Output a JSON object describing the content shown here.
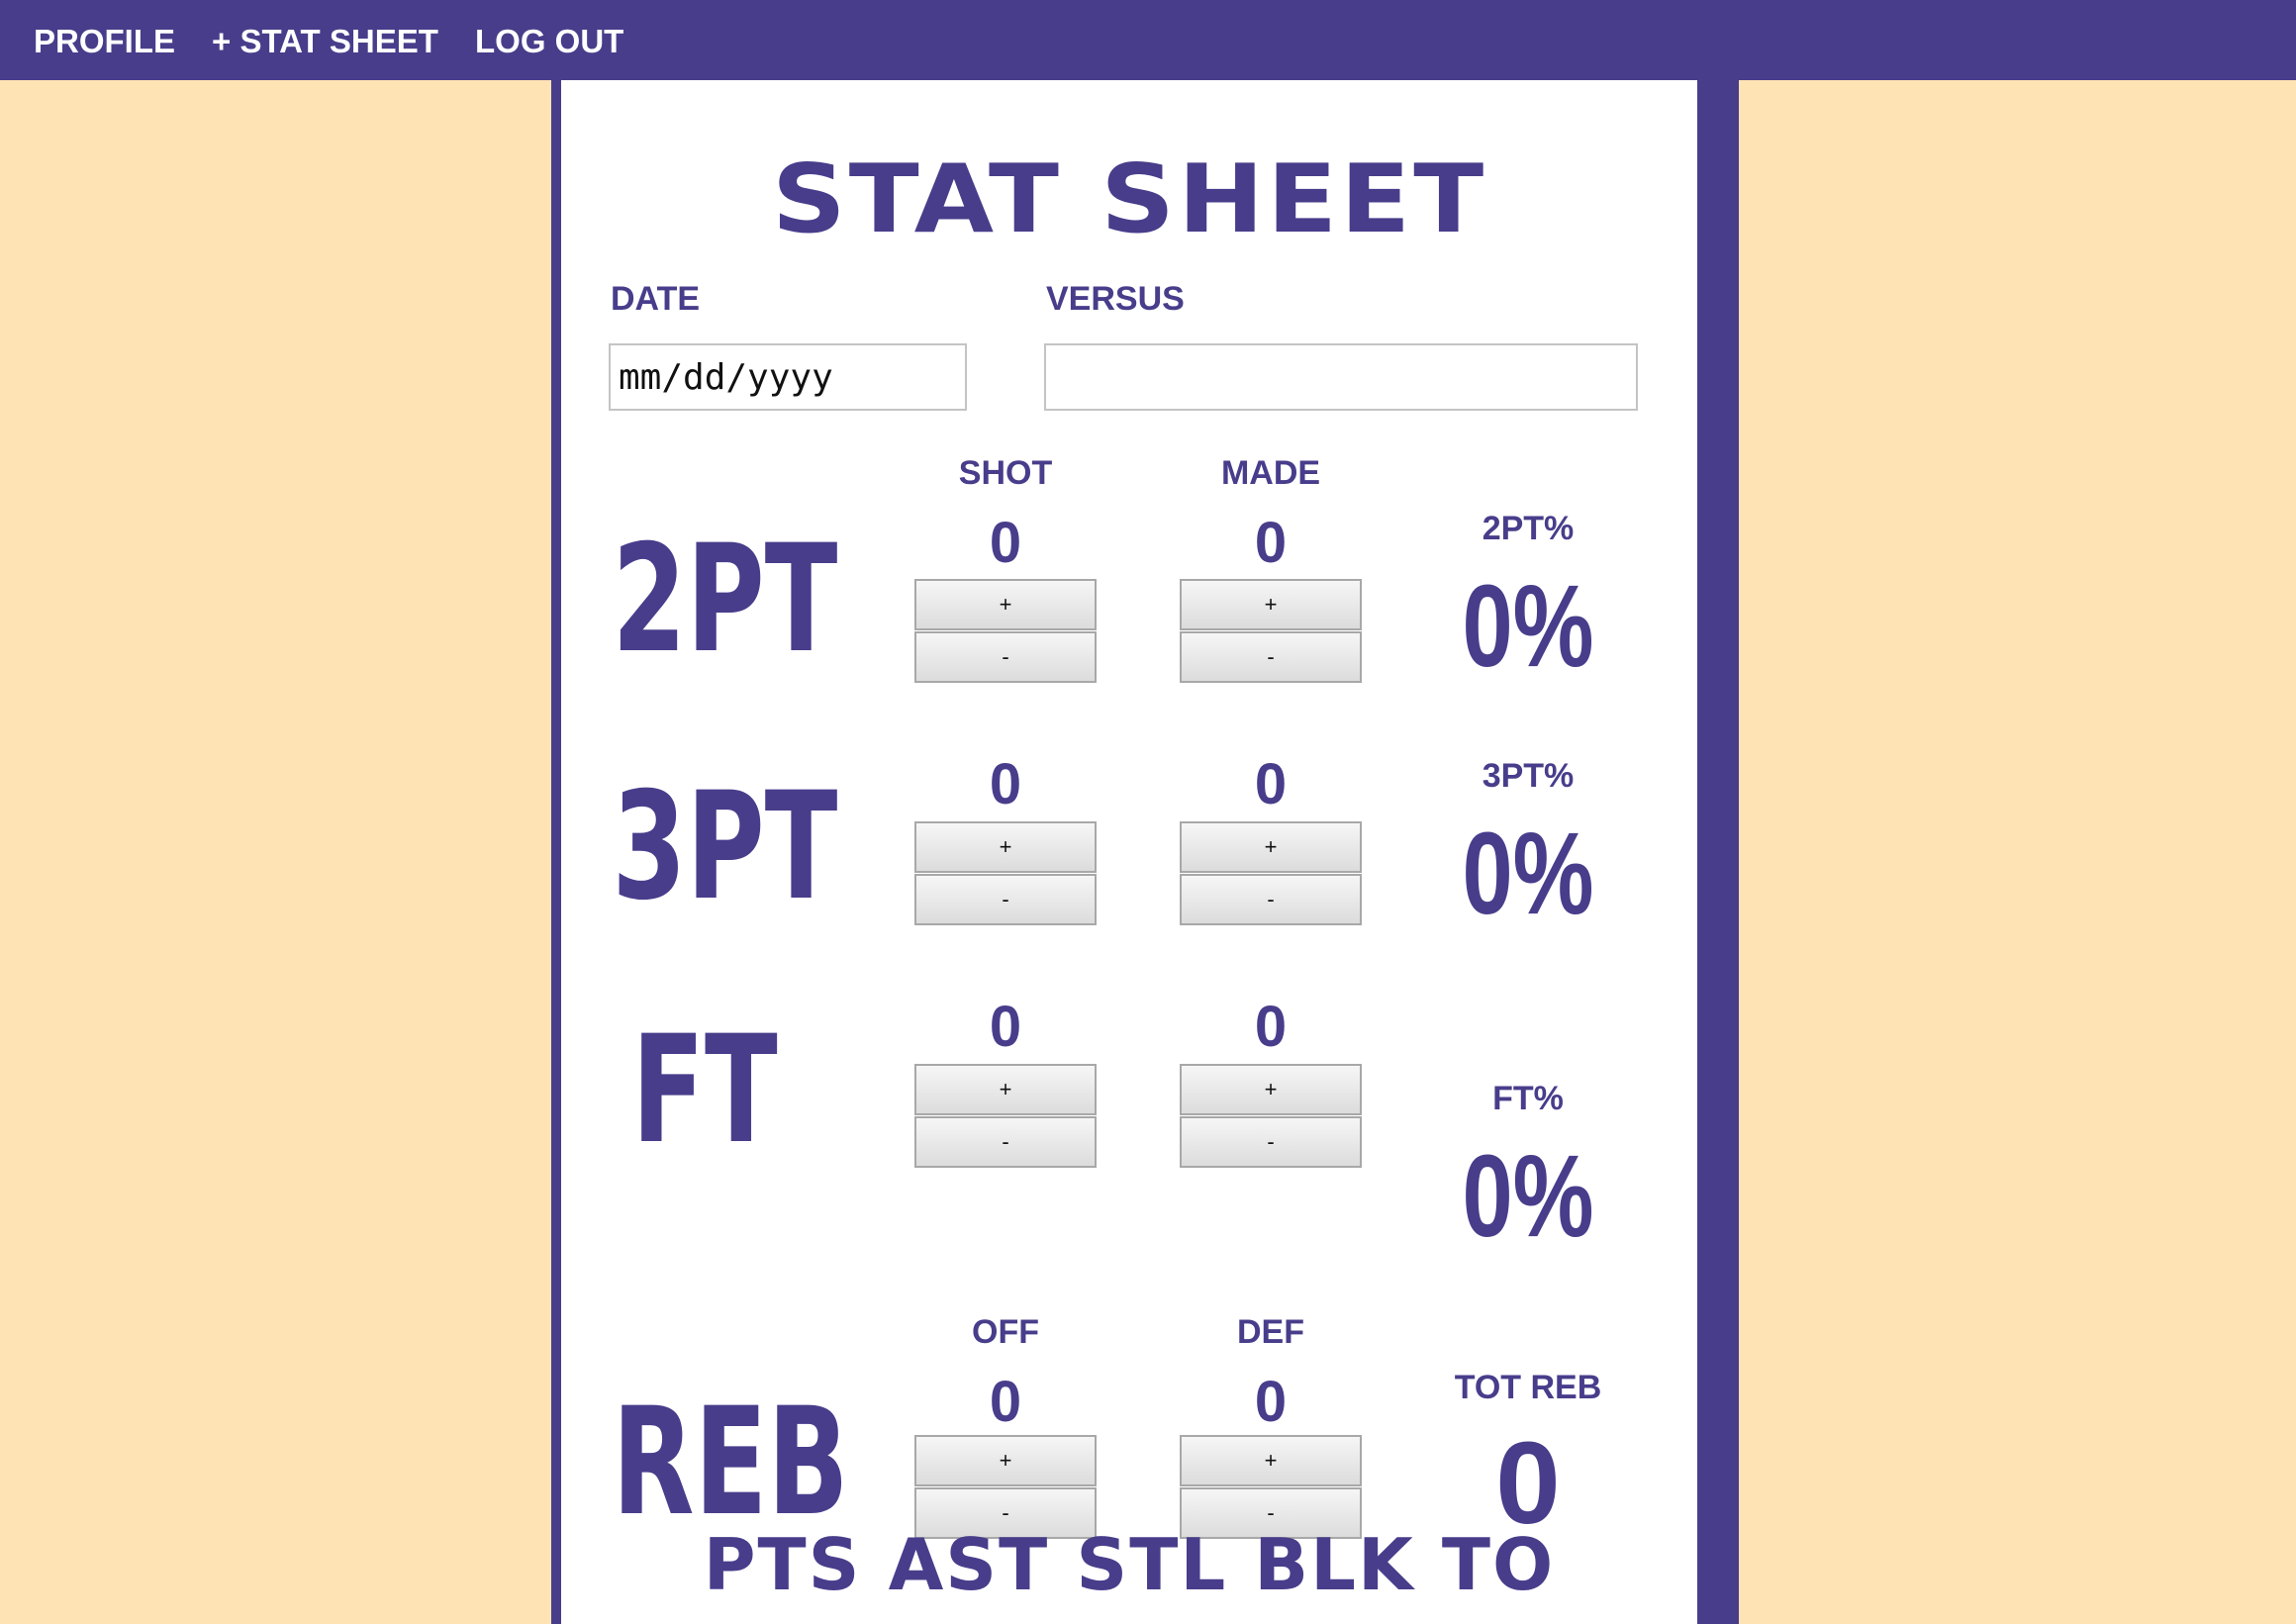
{
  "nav": {
    "profile": "PROFILE",
    "stat_sheet": "+ STAT SHEET",
    "log_out": "LOG OUT"
  },
  "sheet": {
    "title": "STAT SHEET",
    "date_label": "DATE",
    "date_placeholder": "mm/dd/yyyy",
    "versus_label": "VERSUS",
    "versus_value": ""
  },
  "shot_headers": {
    "shot": "SHOT",
    "made": "MADE"
  },
  "reb_headers": {
    "off": "OFF",
    "def": "DEF"
  },
  "button_labels": {
    "plus": "+",
    "minus": "-"
  },
  "rows": {
    "two_pt": {
      "label": "2PT",
      "shot": "0",
      "made": "0",
      "pct_label": "2PT%",
      "pct": "0%"
    },
    "three_pt": {
      "label": "3PT",
      "shot": "0",
      "made": "0",
      "pct_label": "3PT%",
      "pct": "0%"
    },
    "ft": {
      "label": "FT",
      "shot": "0",
      "made": "0",
      "pct_label": "FT%",
      "pct": "0%"
    },
    "reb": {
      "label": "REB",
      "off": "0",
      "def": "0",
      "total_label": "TOT REB",
      "total": "0"
    }
  },
  "footer_stats": "PTS AST STL BLK TO",
  "colors": {
    "primary": "#483d8b",
    "background": "#fee3b4",
    "panel": "#ffffff"
  }
}
